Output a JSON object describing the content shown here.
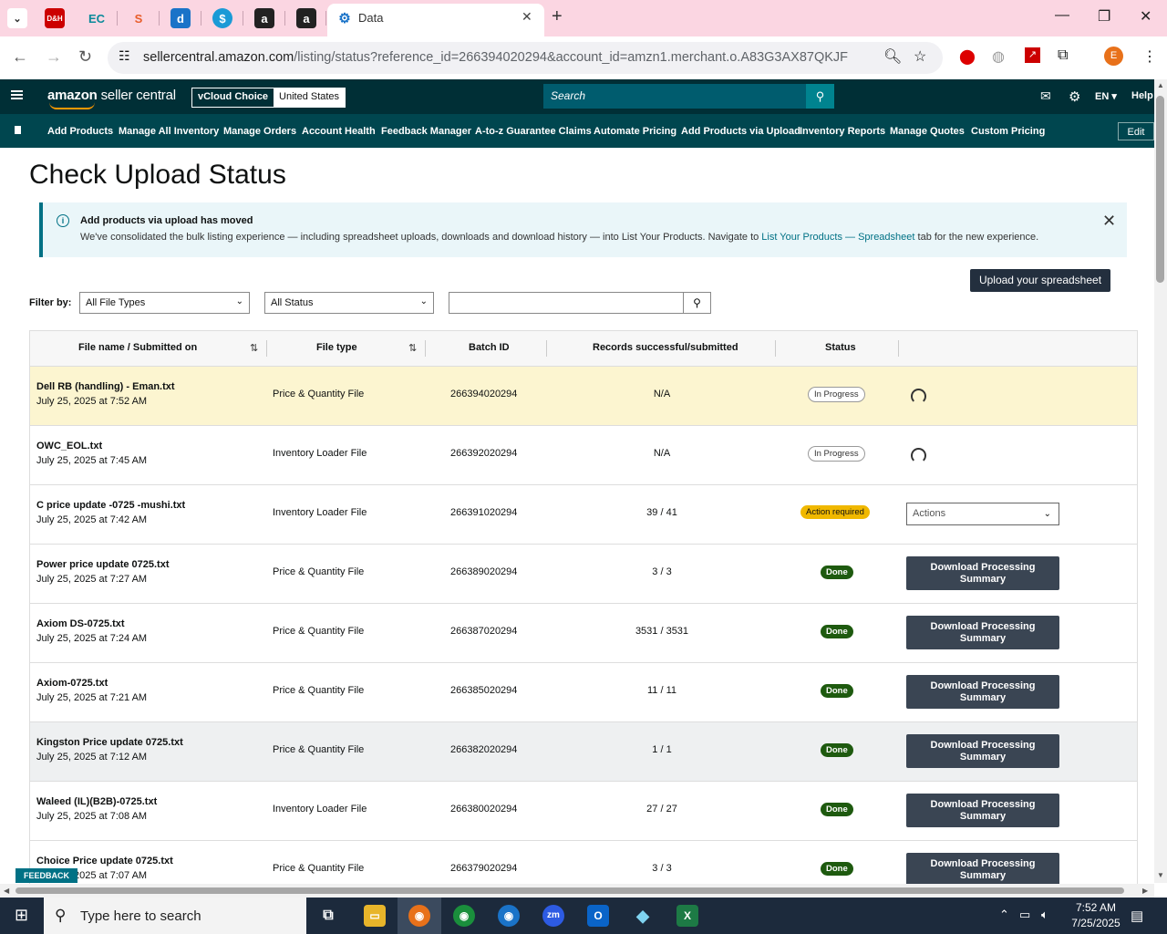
{
  "browser": {
    "tab_title": "Data",
    "url_host": "sellercentral.amazon.com",
    "url_path": "/listing/status?reference_id=266394020294&account_id=amzn1.merchant.o.A83G3AX87QKJF",
    "profile_initial": "E"
  },
  "header": {
    "logo_main": "amazon",
    "logo_sub": " seller central",
    "account_name": "vCloud Choice",
    "account_region": "United States",
    "search_placeholder": "Search",
    "language": "EN",
    "help": "Help"
  },
  "nav": {
    "items": [
      "Add Products",
      "Manage All Inventory",
      "Manage Orders",
      "Account Health",
      "Feedback Manager",
      "A-to-z Guarantee Claims",
      "Automate Pricing",
      "Add Products via Upload",
      "Inventory Reports",
      "Manage Quotes",
      "Custom Pricing"
    ],
    "edit": "Edit"
  },
  "page": {
    "title": "Check Upload Status",
    "banner_title": "Add products via upload has moved",
    "banner_text_pre": "We've consolidated the bulk listing experience — including spreadsheet uploads, downloads and download history — into List Your Products. Navigate to ",
    "banner_link": "List Your Products — Spreadsheet",
    "banner_text_post": " tab for the new experience.",
    "upload_button": "Upload your spreadsheet",
    "filter_label": "Filter by:",
    "filter_file_type": "All File Types",
    "filter_status": "All Status"
  },
  "table": {
    "headers": [
      "File name / Submitted on",
      "File type",
      "Batch ID",
      "Records successful/submitted",
      "Status"
    ],
    "rows": [
      {
        "name": "Dell RB (handling) - Eman.txt",
        "date": "July 25, 2025 at 7:52 AM",
        "type": "Price & Quantity File",
        "batch": "266394020294",
        "records": "N/A",
        "status": "In Progress",
        "action": ""
      },
      {
        "name": "OWC_EOL.txt",
        "date": "July 25, 2025 at 7:45 AM",
        "type": "Inventory Loader File",
        "batch": "266392020294",
        "records": "N/A",
        "status": "In Progress",
        "action": ""
      },
      {
        "name": "C price update -0725 -mushi.txt",
        "date": "July 25, 2025 at 7:42 AM",
        "type": "Inventory Loader File",
        "batch": "266391020294",
        "records": "39 / 41",
        "status": "Action required",
        "action": "Actions"
      },
      {
        "name": "Power price update 0725.txt",
        "date": "July 25, 2025 at 7:27 AM",
        "type": "Price & Quantity File",
        "batch": "266389020294",
        "records": "3 / 3",
        "status": "Done",
        "action": "Download Processing Summary"
      },
      {
        "name": "Axiom DS-0725.txt",
        "date": "July 25, 2025 at 7:24 AM",
        "type": "Price & Quantity File",
        "batch": "266387020294",
        "records": "3531 / 3531",
        "status": "Done",
        "action": "Download Processing Summary"
      },
      {
        "name": "Axiom-0725.txt",
        "date": "July 25, 2025 at 7:21 AM",
        "type": "Price & Quantity File",
        "batch": "266385020294",
        "records": "11 / 11",
        "status": "Done",
        "action": "Download Processing Summary"
      },
      {
        "name": "Kingston Price update 0725.txt",
        "date": "July 25, 2025 at 7:12 AM",
        "type": "Price & Quantity File",
        "batch": "266382020294",
        "records": "1 / 1",
        "status": "Done",
        "action": "Download Processing Summary"
      },
      {
        "name": "Waleed (IL)(B2B)-0725.txt",
        "date": "July 25, 2025 at 7:08 AM",
        "type": "Inventory Loader File",
        "batch": "266380020294",
        "records": "27 / 27",
        "status": "Done",
        "action": "Download Processing Summary"
      },
      {
        "name": "Choice Price update 0725.txt",
        "date": "July 25, 2025 at 7:07 AM",
        "type": "Price & Quantity File",
        "batch": "266379020294",
        "records": "3 / 3",
        "status": "Done",
        "action": "Download Processing Summary"
      }
    ]
  },
  "feedback": "FEEDBACK ✕",
  "taskbar": {
    "search_placeholder": "Type here to search",
    "time": "7:52 AM",
    "date": "7/25/2025"
  }
}
